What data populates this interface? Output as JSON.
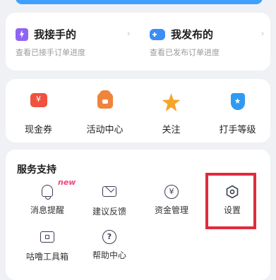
{
  "orders": {
    "taken": {
      "title": "我接手的",
      "subtitle": "查看已接手订单进度"
    },
    "published": {
      "title": "我发布的",
      "subtitle": "查看已发布订单进度"
    },
    "chevron": "›"
  },
  "quick_actions": [
    {
      "label": "现金券",
      "icon": "cash-coupon-icon"
    },
    {
      "label": "活动中心",
      "icon": "gift-icon"
    },
    {
      "label": "关注",
      "icon": "star-icon"
    },
    {
      "label": "打手等级",
      "icon": "shield-star-icon"
    }
  ],
  "service": {
    "title": "服务支持",
    "new_badge": "new",
    "items": [
      {
        "label": "消息提醒",
        "icon": "bell-icon"
      },
      {
        "label": "建议反馈",
        "icon": "envelope-icon"
      },
      {
        "label": "资金管理",
        "icon": "yen-icon",
        "glyph": "¥"
      },
      {
        "label": "设置",
        "icon": "settings-hexagon-icon"
      },
      {
        "label": "咕噜工具箱",
        "icon": "toolbox-icon"
      },
      {
        "label": "帮助中心",
        "icon": "help-icon",
        "glyph": "?"
      }
    ]
  },
  "colors": {
    "accent_blue": "#3fa0ff",
    "highlight_red": "#e02a3c",
    "new_pink": "#f0457a"
  }
}
